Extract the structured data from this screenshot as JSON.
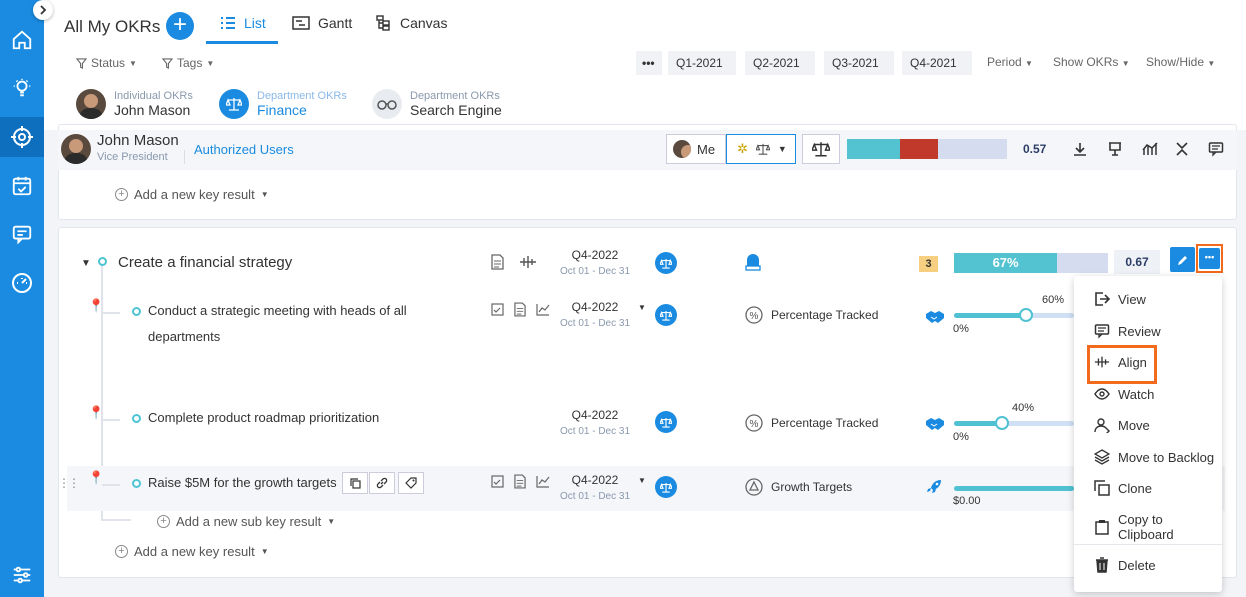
{
  "header": {
    "title": "All My OKRs",
    "views": [
      {
        "label": "List"
      },
      {
        "label": "Gantt"
      },
      {
        "label": "Canvas"
      }
    ]
  },
  "filters": {
    "status": "Status",
    "tags": "Tags",
    "quarters": [
      "Q1-2021",
      "Q2-2021",
      "Q3-2021",
      "Q4-2021"
    ],
    "period": "Period",
    "show_okrs": "Show OKRs",
    "show_hide": "Show/Hide"
  },
  "okr_tabs": [
    {
      "small": "Individual OKRs",
      "big": "John Mason"
    },
    {
      "small": "Department OKRs",
      "big": "Finance"
    },
    {
      "small": "Department OKRs",
      "big": "Search Engine"
    }
  ],
  "owner": {
    "name": "John Mason",
    "role": "Vice President",
    "authorized": "Authorized Users",
    "me": "Me",
    "score": "0.57"
  },
  "top_card": {
    "add_kr": "Add a new key result"
  },
  "objective": {
    "title": "Create a financial strategy",
    "quarter": "Q4-2022",
    "dates": "Oct 01 - Dec 31",
    "count": "3",
    "progress": "67%",
    "progress_value": 0.67,
    "score": "0.67"
  },
  "key_results": [
    {
      "title_line1": "Conduct a strategic meeting with heads of all",
      "title_line2": "departments",
      "quarter": "Q4-2022",
      "dates": "Oct 01 - Dec 31",
      "type": "Percentage Tracked",
      "value": "60%",
      "start": "0%",
      "progress_value": 0.6
    },
    {
      "title_line1": "Complete product roadmap prioritization",
      "quarter": "Q4-2022",
      "dates": "Oct 01 - Dec 31",
      "type": "Percentage Tracked",
      "value": "40%",
      "start": "0%",
      "progress_value": 0.4
    },
    {
      "title_line1": "Raise $5M for the growth targets",
      "quarter": "Q4-2022",
      "dates": "Oct 01 - Dec 31",
      "type": "Growth Targets",
      "start": "$0.00"
    }
  ],
  "add_sub_kr": "Add a new sub key result",
  "add_kr": "Add a new key result",
  "menu": {
    "items": [
      "View",
      "Review",
      "Align",
      "Watch",
      "Move",
      "Move to Backlog",
      "Clone",
      "Copy to Clipboard",
      "Delete"
    ]
  },
  "colors": {
    "accent": "#1a8be0",
    "highlight": "#f26a1b",
    "progress": "#4fc1d2",
    "red": "#c0392b"
  }
}
